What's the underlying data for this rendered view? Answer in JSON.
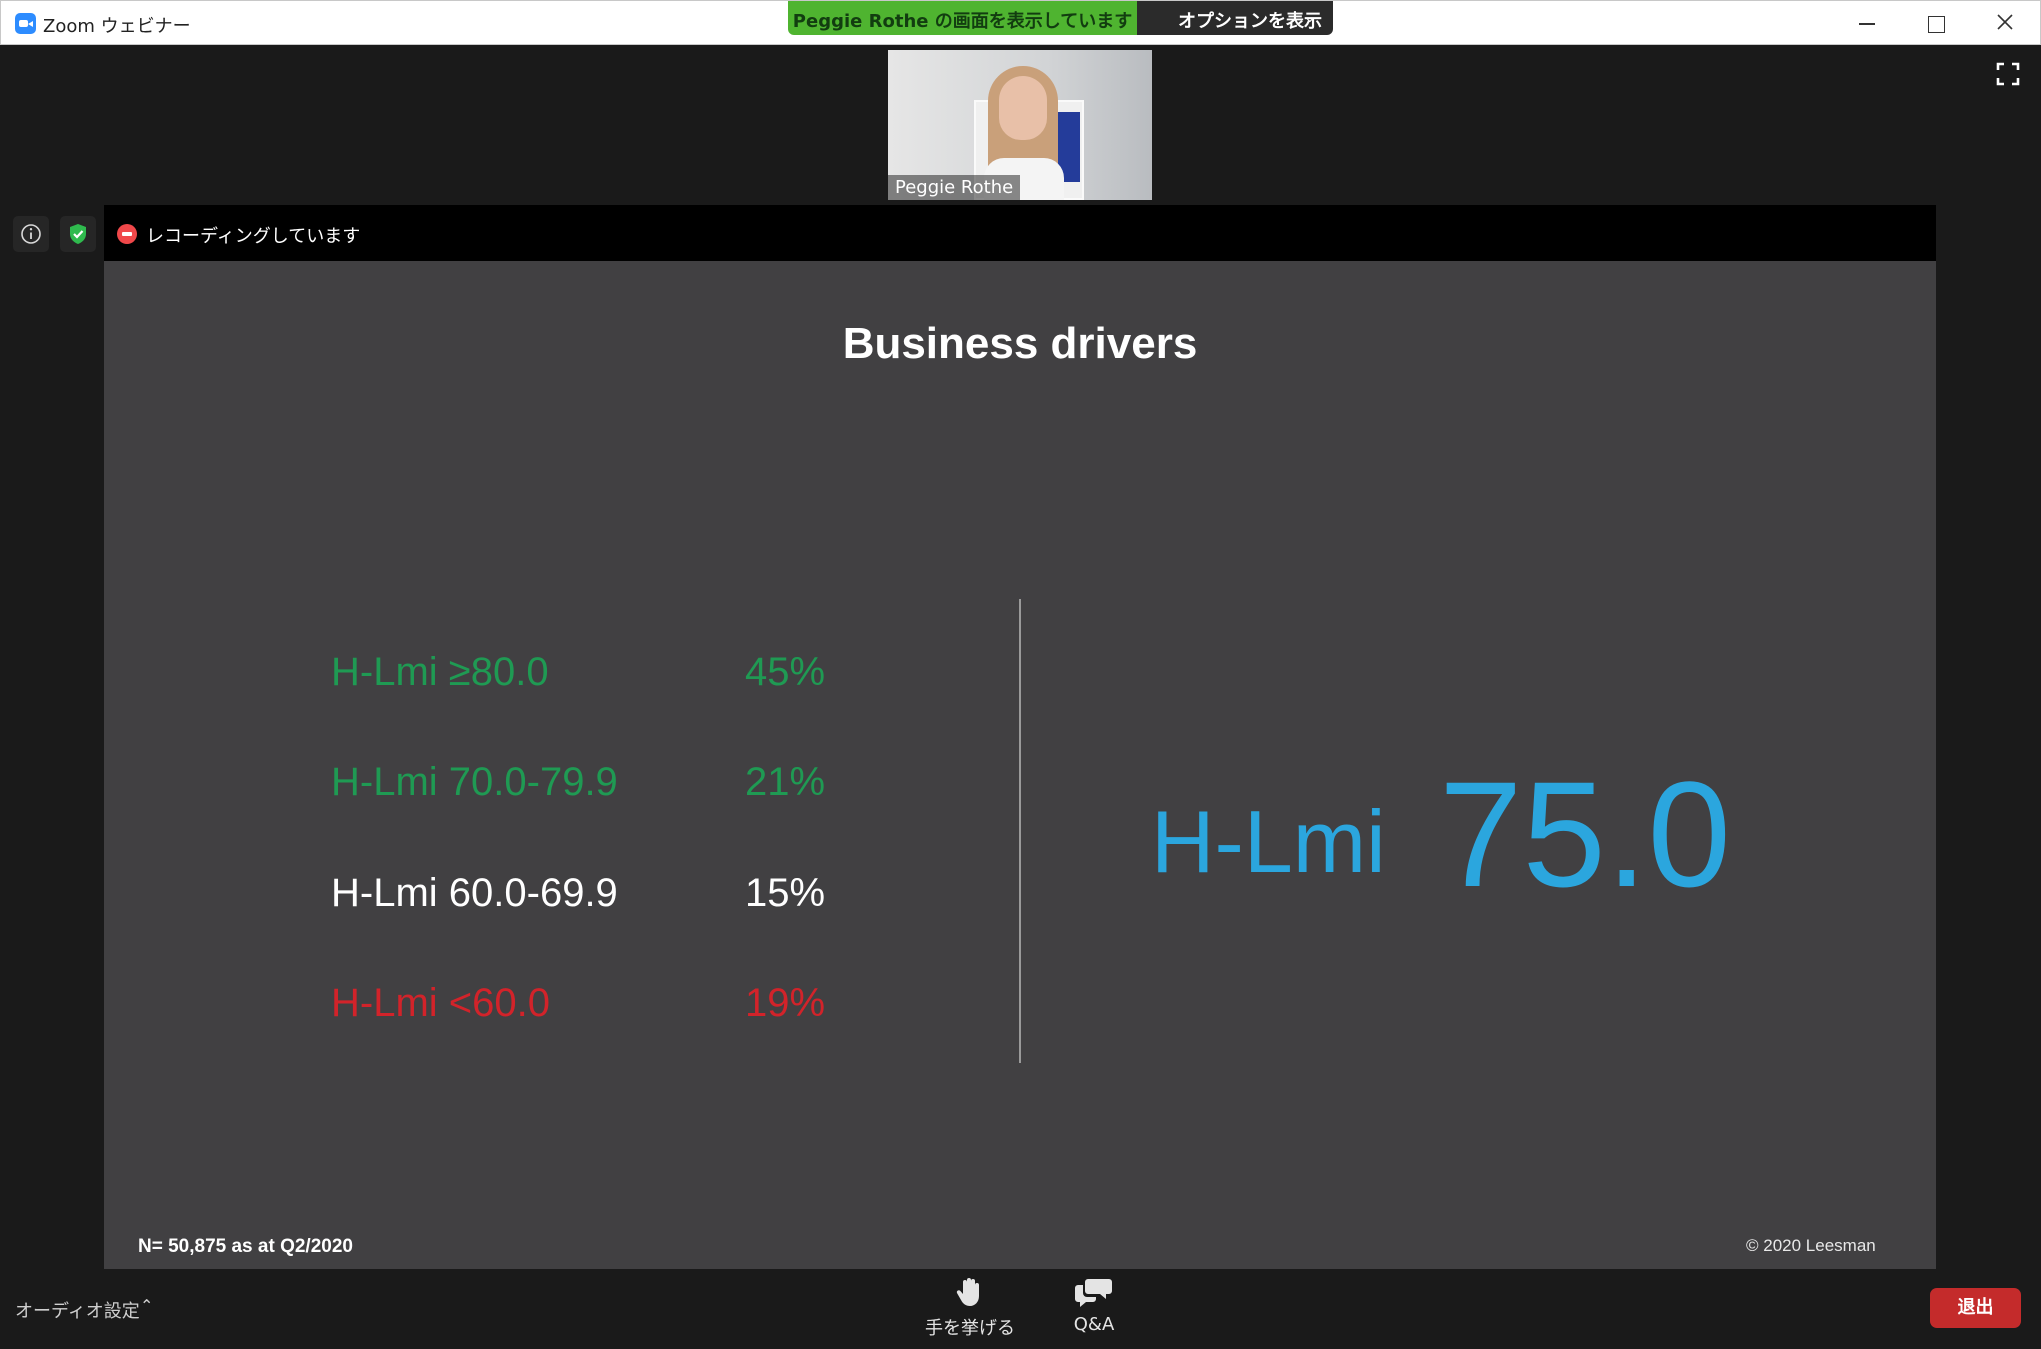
{
  "window": {
    "title": "Zoom ウェビナー",
    "sharing_banner": "Peggie  Rothe の画面を表示しています",
    "options_label": "オプションを表示"
  },
  "participant": {
    "name": "Peggie Rothe"
  },
  "recording": {
    "status": "レコーディングしています"
  },
  "slide": {
    "title": "Business drivers",
    "bands": [
      {
        "label": "H-Lmi ≥80.0",
        "percent": "45%",
        "color": "#1f9a53"
      },
      {
        "label": "H-Lmi 70.0-79.9",
        "percent": "21%",
        "color": "#1f9a53"
      },
      {
        "label": "H-Lmi 60.0-69.9",
        "percent": "15%",
        "color": "#ffffff"
      },
      {
        "label": "H-Lmi <60.0",
        "percent": "19%",
        "color": "#d2232a"
      }
    ],
    "score_label": "H-Lmi",
    "score_value": "75.0",
    "score_color": "#2ba6de",
    "footnote_left": "N= 50,875 as at Q2/2020",
    "footnote_right": "© 2020 Leesman"
  },
  "toolbar": {
    "audio_settings": "オーディオ設定",
    "raise_hand": "手を挙げる",
    "qa": "Q&A",
    "leave": "退出"
  },
  "colors": {
    "share_green": "#4fb430",
    "leave_red": "#c42b2b",
    "slide_bg": "#414042"
  }
}
